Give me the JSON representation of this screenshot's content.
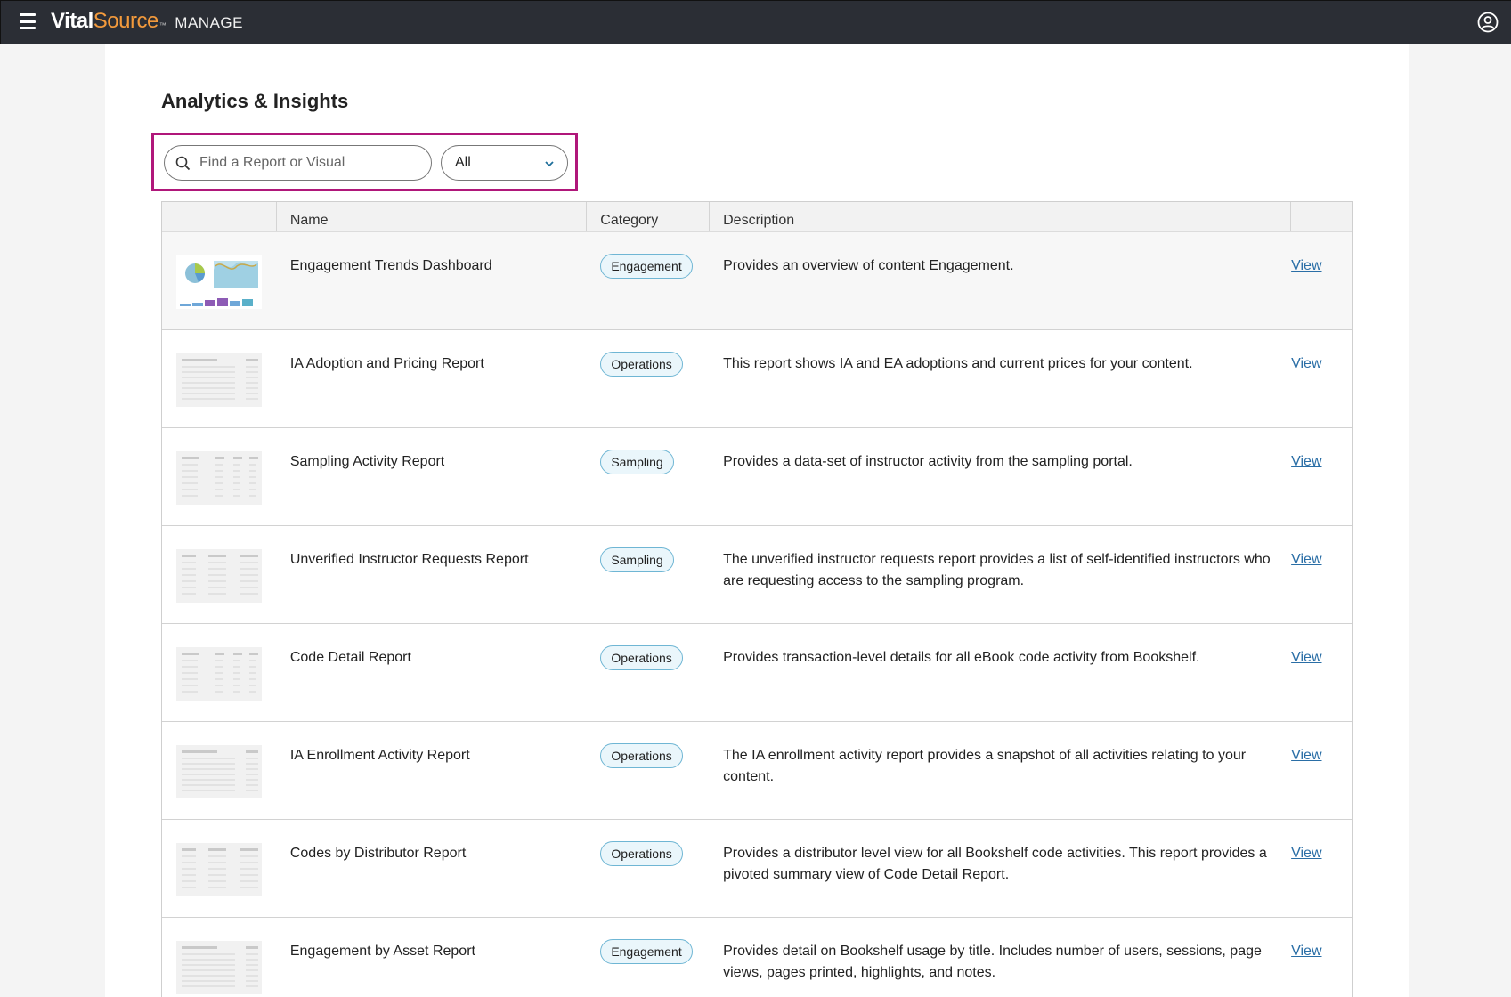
{
  "header": {
    "logo_vital": "Vital",
    "logo_source": "Source",
    "logo_tm": "™",
    "logo_manage": "MANAGE",
    "icons": [
      "hamburger-icon",
      "user-account-icon"
    ]
  },
  "page": {
    "title": "Analytics & Insights"
  },
  "filters": {
    "search_placeholder": "Find a Report or Visual",
    "search_value": "",
    "category_selected": "All"
  },
  "table": {
    "columns": [
      "",
      "Name",
      "Category",
      "Description",
      ""
    ],
    "rows": [
      {
        "name": "Engagement Trends Dashboard",
        "category": "Engagement",
        "description": "Provides an overview of content Engagement.",
        "action": "View",
        "thumb": "dashboard"
      },
      {
        "name": "IA Adoption and Pricing Report",
        "category": "Operations",
        "description": "This report shows IA and EA adoptions and current prices for your content.",
        "action": "View",
        "thumb": "table-a"
      },
      {
        "name": "Sampling Activity Report",
        "category": "Sampling",
        "description": "Provides a data-set of instructor activity from the sampling portal.",
        "action": "View",
        "thumb": "table-b"
      },
      {
        "name": "Unverified Instructor Requests Report",
        "category": "Sampling",
        "description": "The unverified instructor requests report provides a list of self-identified instructors who are requesting access to the sampling program.",
        "action": "View",
        "thumb": "table-c"
      },
      {
        "name": "Code Detail Report",
        "category": "Operations",
        "description": "Provides transaction-level details for all eBook code activity from Bookshelf.",
        "action": "View",
        "thumb": "table-b"
      },
      {
        "name": "IA Enrollment Activity Report",
        "category": "Operations",
        "description": "The IA enrollment activity report provides a snapshot of all activities relating to your content.",
        "action": "View",
        "thumb": "table-a"
      },
      {
        "name": "Codes by Distributor Report",
        "category": "Operations",
        "description": "Provides a distributor level view for all Bookshelf code activities. This report provides a pivoted summary view of Code Detail Report.",
        "action": "View",
        "thumb": "table-c"
      },
      {
        "name": "Engagement by Asset Report",
        "category": "Engagement",
        "description": "Provides detail on Bookshelf usage by title. Includes number of users, sessions, page views, pages printed, highlights, and notes.",
        "action": "View",
        "thumb": "table-a"
      }
    ]
  }
}
